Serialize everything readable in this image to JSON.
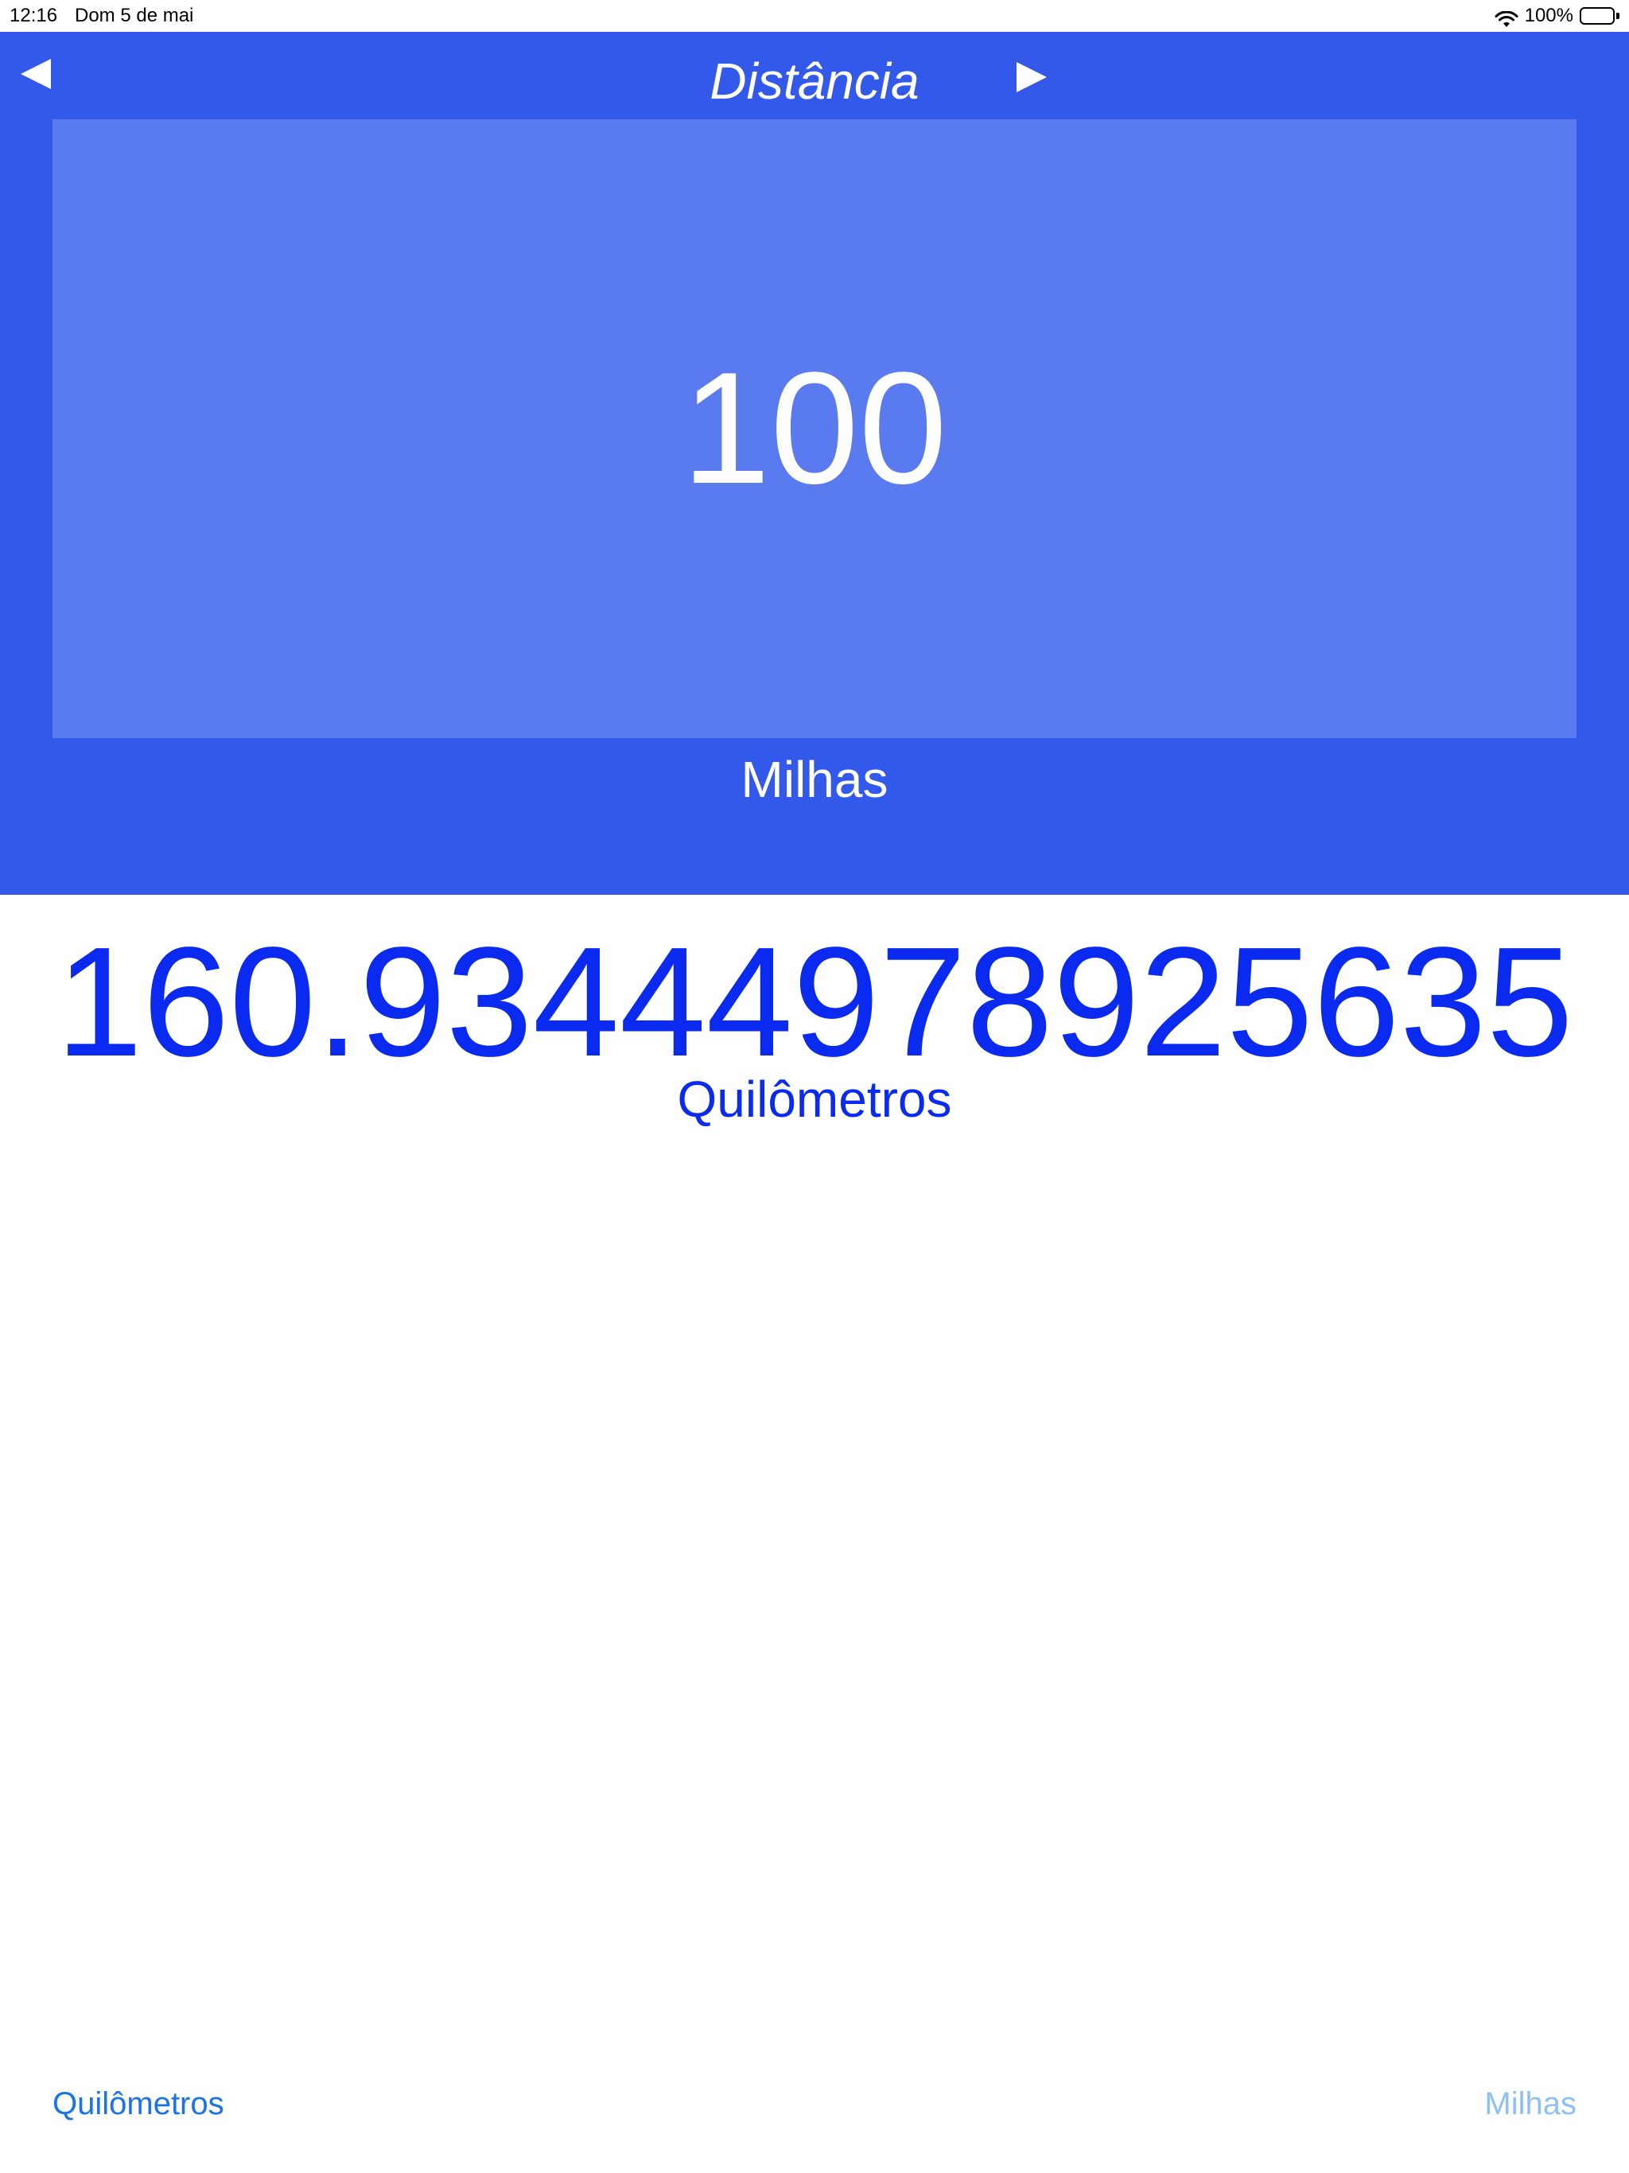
{
  "status_bar": {
    "time": "12:16",
    "date": "Dom 5 de mai",
    "battery": "100%",
    "icons": [
      "wifi-icon",
      "battery-icon"
    ]
  },
  "header": {
    "title": "Distância",
    "prev_icon": "triangle-left-icon",
    "next_icon": "triangle-right-icon",
    "background_color": "#3259ea"
  },
  "input": {
    "value": "100",
    "unit": "Milhas",
    "panel_color": "#5a7af0"
  },
  "result": {
    "value": "160.93444978925635",
    "unit": "Quilômetros",
    "color": "#0a2af0"
  },
  "bottom_bar": {
    "left_label": "Quilômetros",
    "right_label": "Milhas",
    "left_color": "#1a73e8",
    "right_color": "#8ec0f5"
  }
}
